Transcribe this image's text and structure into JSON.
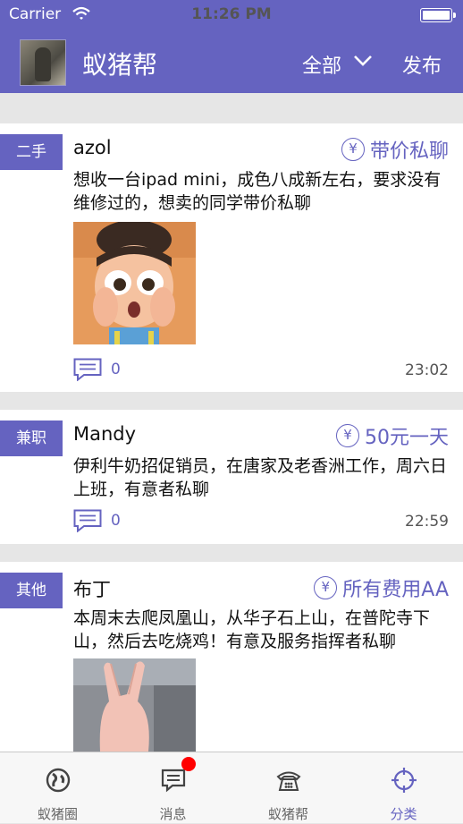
{
  "status_bar": {
    "carrier": "Carrier",
    "time": "11:26 PM"
  },
  "nav": {
    "title": "蚁猪帮",
    "filter": "全部",
    "publish": "发布"
  },
  "colors": {
    "accent": "#6563c0",
    "badge": "#ff0000"
  },
  "posts": [
    {
      "tag": "二手",
      "username": "azol",
      "price": "带价私聊",
      "content": "想收一台ipad mini，成色八成新左右，要求没有维修过的，想卖的同学带价私聊",
      "has_image": true,
      "comments": "0",
      "time": "23:02"
    },
    {
      "tag": "兼职",
      "username": "Mandy",
      "price": "50元一天",
      "content": "伊利牛奶招促销员，在唐家及老香洲工作，周六日上班，有意者私聊",
      "has_image": false,
      "comments": "0",
      "time": "22:59"
    },
    {
      "tag": "其他",
      "username": "布丁",
      "price": "所有费用AA",
      "content": "本周末去爬凤凰山，从华子石上山，在普陀寺下山，然后去吃烧鸡！有意及服务指挥者私聊",
      "has_image": true
    }
  ],
  "tabs": [
    {
      "label": "蚁猪圈",
      "icon": "globe-icon",
      "active": false
    },
    {
      "label": "消息",
      "icon": "message-icon",
      "active": false,
      "badge": true
    },
    {
      "label": "蚁猪帮",
      "icon": "telephone-icon",
      "active": false
    },
    {
      "label": "分类",
      "icon": "crosshair-icon",
      "active": true
    }
  ]
}
